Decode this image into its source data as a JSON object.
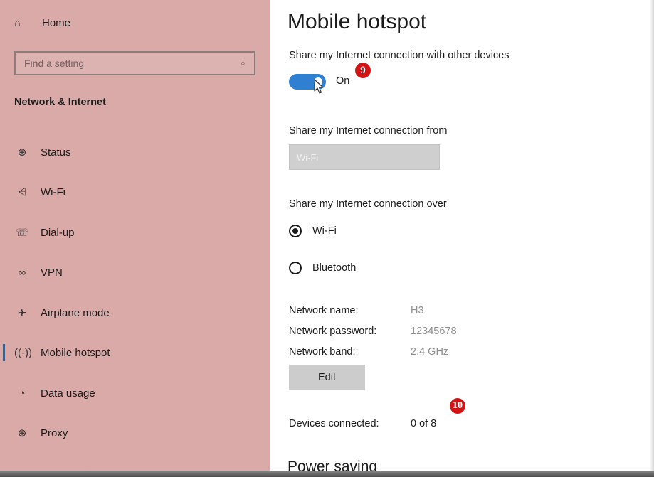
{
  "sidebar": {
    "home_label": "Home",
    "search_placeholder": "Find a setting",
    "section_title": "Network & Internet",
    "items": [
      {
        "label": "Status",
        "icon": "globe-icon"
      },
      {
        "label": "Wi-Fi",
        "icon": "wifi-icon"
      },
      {
        "label": "Dial-up",
        "icon": "phone-icon"
      },
      {
        "label": "VPN",
        "icon": "vpn-icon"
      },
      {
        "label": "Airplane mode",
        "icon": "airplane-icon"
      },
      {
        "label": "Mobile hotspot",
        "icon": "hotspot-icon",
        "active": true
      },
      {
        "label": "Data usage",
        "icon": "pie-icon"
      },
      {
        "label": "Proxy",
        "icon": "globe-icon"
      }
    ]
  },
  "main": {
    "title": "Mobile hotspot",
    "share_label": "Share my Internet connection with other devices",
    "toggle_state": "On",
    "share_from_label": "Share my Internet connection from",
    "share_from_value": "Wi-Fi",
    "share_over_label": "Share my Internet connection over",
    "share_over_options": [
      "Wi-Fi",
      "Bluetooth"
    ],
    "share_over_selected": "Wi-Fi",
    "network_name_label": "Network name:",
    "network_name": "H3",
    "network_password_label": "Network password:",
    "network_password": "12345678",
    "network_band_label": "Network band:",
    "network_band": "2.4 GHz",
    "edit_label": "Edit",
    "devices_label": "Devices connected:",
    "devices_value": "0 of 8",
    "power_saving_title": "Power saving"
  },
  "annotations": {
    "step_9": "9",
    "step_10": "10"
  },
  "colors": {
    "sidebar_bg": "#d9aaa8",
    "toggle_on": "#2f7fd3",
    "badge": "#d31414"
  }
}
